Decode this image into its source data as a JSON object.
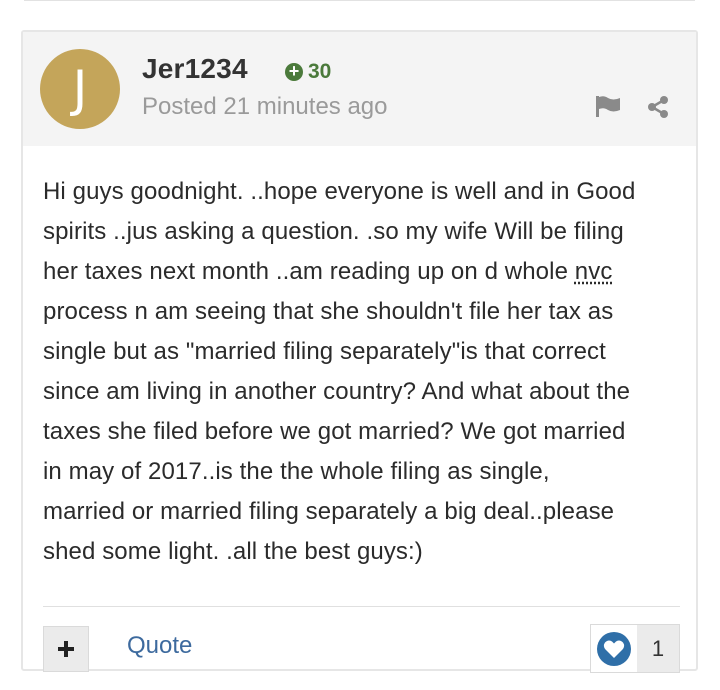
{
  "post": {
    "author": {
      "avatar_letter": "J",
      "username": "Jer1234",
      "reputation": "30"
    },
    "posted_time": "Posted 21 minutes ago",
    "body_lines": [
      "Hi guys goodnight. ..hope everyone is well and in Good",
      "spirits ..jus asking a question. .so my wife Will be filing",
      "her taxes next month ..am reading up on d whole ",
      "process n am seeing that she shouldn't file her tax as",
      "single but as \"married filing separately\"is that correct",
      "since am living in another country? And what about the",
      "taxes she filed before we got married? We got married",
      "in may of 2017..is the the whole filing as single,",
      "married or married filing separately a big deal..please",
      "shed some light. .all the best guys:)"
    ],
    "abbr": "nvc"
  },
  "actions": {
    "plus_label": "+",
    "quote_label": "Quote",
    "reaction_count": "1"
  },
  "icons": {
    "flag": "flag-icon",
    "share": "share-icon",
    "reputation": "plus-circle-icon",
    "like": "heart-icon"
  },
  "colors": {
    "avatar_bg": "#c4a55a",
    "reputation": "#4b7a3b",
    "link": "#3d6a9e",
    "like": "#2f6fa8"
  }
}
